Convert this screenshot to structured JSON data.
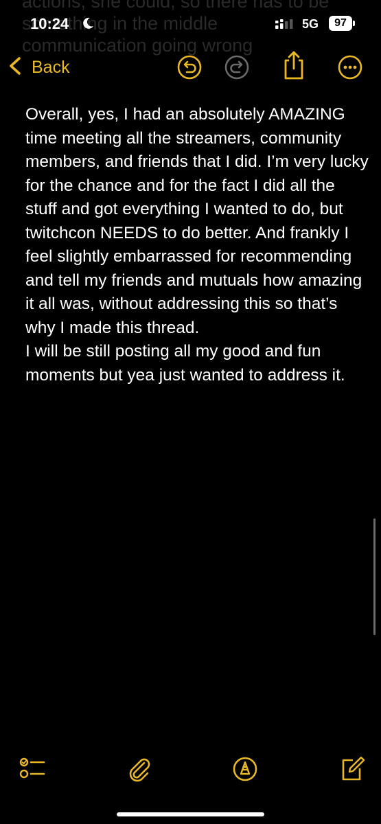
{
  "ghost_text": "actions, she could, so there has to be\nsomething in the middle\ncommunication going wrong",
  "status_bar": {
    "time": "10:24",
    "network": "5G",
    "battery": "97"
  },
  "toolbar": {
    "back_label": "Back"
  },
  "note": {
    "paragraphs": [
      "Overall, yes, I had an absolutely AMAZING time meeting all the streamers, community members, and friends that I did. I’m very lucky for the chance and for the fact I did all the stuff and got everything I wanted to do, but twitchcon NEEDS to do better. And frankly I feel slightly embarrassed for recommending and tell my friends and mutuals how amazing it all was, without addressing this so that’s why I made this thread.",
      "I will be still posting all my good and fun moments but yea just wanted to address it."
    ]
  },
  "colors": {
    "accent": "#e9b824",
    "background": "#000000",
    "text": "#ffffff"
  },
  "icons": {
    "status": [
      "moon-icon",
      "signal-icon",
      "battery-icon"
    ],
    "toolbar": [
      "chevron-left-icon",
      "undo-icon",
      "redo-icon",
      "share-icon",
      "more-icon"
    ],
    "bottom": [
      "checklist-icon",
      "paperclip-icon",
      "markup-icon",
      "compose-icon"
    ]
  }
}
